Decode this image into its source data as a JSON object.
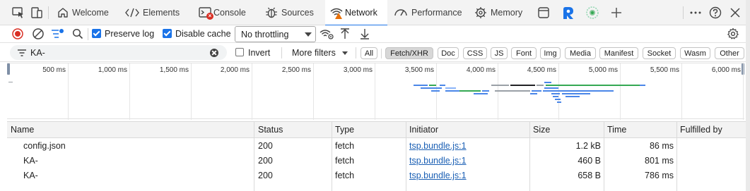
{
  "tabs": [
    {
      "label": "Welcome",
      "icon": "home-icon"
    },
    {
      "label": "Elements",
      "icon": "code-icon"
    },
    {
      "label": "Console",
      "icon": "console-icon"
    },
    {
      "label": "Sources",
      "icon": "bug-icon"
    },
    {
      "label": "Network",
      "icon": "wifi-icon",
      "active": true
    },
    {
      "label": "Performance",
      "icon": "gauge-icon"
    },
    {
      "label": "Memory",
      "icon": "gear-chip-icon"
    }
  ],
  "toolbar": {
    "preserve_log_label": "Preserve log",
    "preserve_log_checked": true,
    "disable_cache_label": "Disable cache",
    "disable_cache_checked": true,
    "throttling_value": "No throttling"
  },
  "filter": {
    "value": "KA-",
    "invert_label": "Invert",
    "invert_checked": false,
    "more_filters_label": "More filters",
    "chips": [
      "All",
      "Fetch/XHR",
      "Doc",
      "CSS",
      "JS",
      "Font",
      "Img",
      "Media",
      "Manifest",
      "Socket",
      "Wasm",
      "Other"
    ],
    "active_chip": "Fetch/XHR"
  },
  "overview": {
    "ticks": [
      "500 ms",
      "1,000 ms",
      "1,500 ms",
      "2,000 ms",
      "2,500 ms",
      "3,000 ms",
      "3,500 ms",
      "4,000 ms",
      "4,500 ms",
      "5,000 ms",
      "5,500 ms",
      "6,000 ms"
    ]
  },
  "table": {
    "columns": [
      "Name",
      "Status",
      "Type",
      "Initiator",
      "Size",
      "Time",
      "Fulfilled by"
    ],
    "rows": [
      {
        "name": "config.json",
        "status": "200",
        "type": "fetch",
        "initiator": "tsp.bundle.js:1",
        "size": "1.2 kB",
        "time": "86 ms",
        "fulfilled_by": ""
      },
      {
        "name": "KA-",
        "status": "200",
        "type": "fetch",
        "initiator": "tsp.bundle.js:1",
        "size": "460 B",
        "time": "801 ms",
        "fulfilled_by": ""
      },
      {
        "name": "KA-",
        "status": "200",
        "type": "fetch",
        "initiator": "tsp.bundle.js:1",
        "size": "658 B",
        "time": "786 ms",
        "fulfilled_by": ""
      }
    ]
  },
  "colors": {
    "accent": "#1a73e8",
    "record_red": "#d93025",
    "link": "#1a5fb4",
    "waterfall_green": "#34a853",
    "waterfall_blue": "#4a86e8",
    "waterfall_dark": "#202124"
  }
}
